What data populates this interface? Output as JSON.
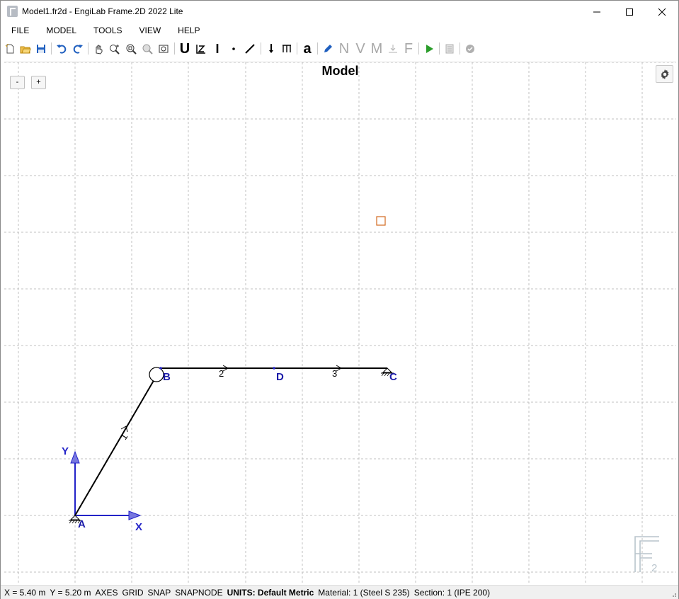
{
  "window": {
    "title": "Model1.fr2d - EngiLab Frame.2D 2022 Lite",
    "minimize_icon": "minimize-icon",
    "maximize_icon": "maximize-icon",
    "close_icon": "close-icon"
  },
  "menu": {
    "items": [
      "FILE",
      "MODEL",
      "TOOLS",
      "VIEW",
      "HELP"
    ]
  },
  "toolbar": {
    "icons": [
      "new-file-icon",
      "open-file-icon",
      "save-icon",
      "undo-icon",
      "redo-icon",
      "pan-icon",
      "zoom-in-icon",
      "zoom-window-icon",
      "zoom-extents-icon",
      "zoom-fit-icon",
      "units-icon",
      "member-type-icon",
      "section-icon",
      "node-icon",
      "member-icon",
      "point-load-icon",
      "distributed-load-icon",
      "annotation-icon",
      "edit-icon",
      "axial-force-icon",
      "shear-force-icon",
      "bending-moment-icon",
      "reactions-icon",
      "results-icon",
      "run-analysis-icon",
      "report-icon",
      "check-icon"
    ],
    "letters": {
      "units": "U",
      "section": "I",
      "annotation": "a",
      "N": "N",
      "V": "V",
      "M": "M",
      "F": "F"
    }
  },
  "canvas": {
    "title": "Model",
    "zoom_out_label": "-",
    "zoom_in_label": "+",
    "settings_icon": "gear-icon",
    "nodes": {
      "A": "A",
      "B": "B",
      "C": "C",
      "D": "D"
    },
    "members": {
      "m1": "1",
      "m2": "2",
      "m3": "3"
    },
    "axes": {
      "x": "X",
      "y": "Y"
    },
    "watermark": "F2",
    "colors": {
      "grid": "#c0c0c0",
      "member": "#000000",
      "node_label": "#1a1aa8",
      "axis": "#2323c8",
      "marker": "#d2691e"
    }
  },
  "status": {
    "x": "X = 5.40 m",
    "y": "Y = 5.20 m",
    "axes": "AXES",
    "grid": "GRID",
    "snap": "SNAP",
    "snapnode": "SNAPNODE",
    "units_label": "UNITS: Default Metric",
    "material": "Material: 1 (Steel S 235)",
    "section": "Section: 1 (IPE 200)"
  }
}
